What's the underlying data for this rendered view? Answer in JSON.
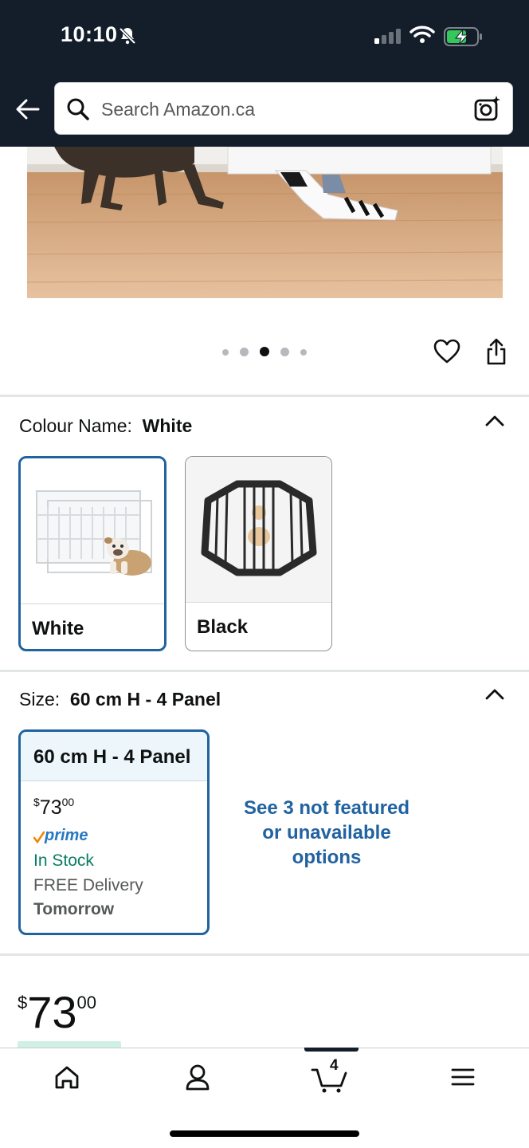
{
  "status_bar": {
    "time": "10:10"
  },
  "header": {
    "search_placeholder": "Search Amazon.ca"
  },
  "carousel": {
    "dot_count": 5,
    "active_index": 2
  },
  "colour": {
    "label": "Colour Name:",
    "selected": "White",
    "options": [
      {
        "label": "White",
        "selected": true
      },
      {
        "label": "Black",
        "selected": false
      }
    ]
  },
  "size": {
    "label": "Size:",
    "selected": "60 cm H - 4 Panel",
    "card": {
      "title": "60 cm H - 4 Panel",
      "price_currency": "$",
      "price_whole": "73",
      "price_cents": "00",
      "prime": "prime",
      "stock": "In Stock",
      "delivery": "FREE Delivery",
      "delivery_day": "Tomorrow"
    },
    "more_options_line1": "See 3 not featured",
    "more_options_line2": "or unavailable",
    "more_options_line3": "options"
  },
  "price": {
    "currency": "$",
    "whole": "73",
    "cents": "00"
  },
  "bottom_nav": {
    "cart_count": "4"
  },
  "colors": {
    "header_bg": "#141d2a",
    "link_blue": "#2162a1",
    "stock_green": "#067d62",
    "prime_blue": "#2578c2"
  }
}
